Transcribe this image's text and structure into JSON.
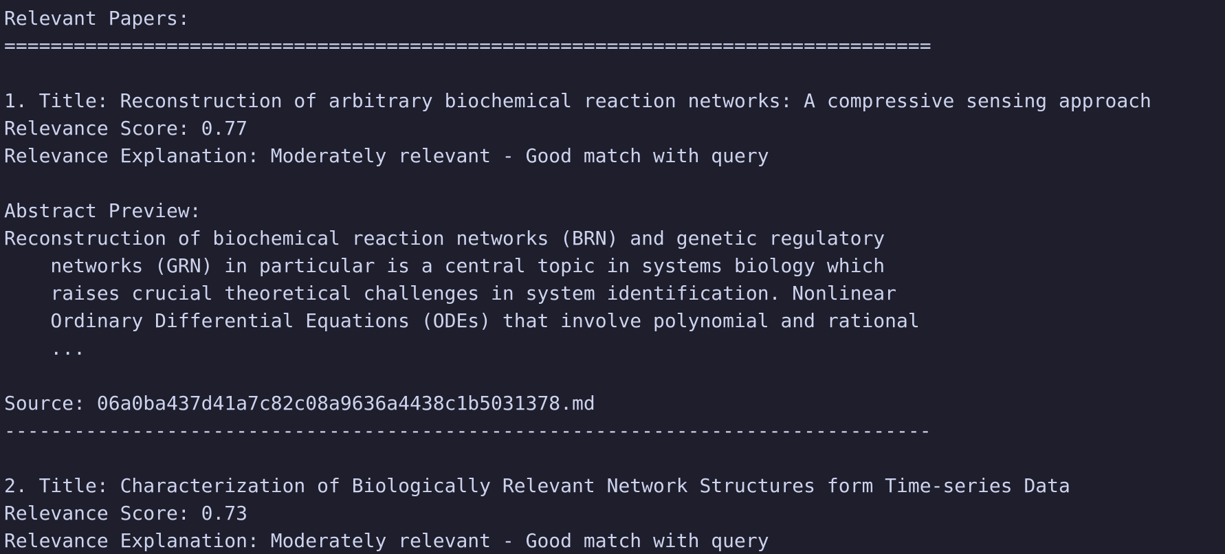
{
  "terminal": {
    "lines": [
      "Relevant Papers:",
      "================================================================================",
      "",
      "1. Title: Reconstruction of arbitrary biochemical reaction networks: A compressive sensing approach",
      "Relevance Score: 0.77",
      "Relevance Explanation: Moderately relevant - Good match with query",
      "",
      "Abstract Preview:",
      "Reconstruction of biochemical reaction networks (BRN) and genetic regulatory",
      "    networks (GRN) in particular is a central topic in systems biology which",
      "    raises crucial theoretical challenges in system identification. Nonlinear",
      "    Ordinary Differential Equations (ODEs) that involve polynomial and rational",
      "    ...",
      "",
      "Source: 06a0ba437d41a7c82c08a9636a4438c1b5031378.md",
      "--------------------------------------------------------------------------------",
      "",
      "2. Title: Characterization of Biologically Relevant Network Structures form Time-series Data",
      "Relevance Score: 0.73",
      "Relevance Explanation: Moderately relevant - Good match with query"
    ]
  }
}
